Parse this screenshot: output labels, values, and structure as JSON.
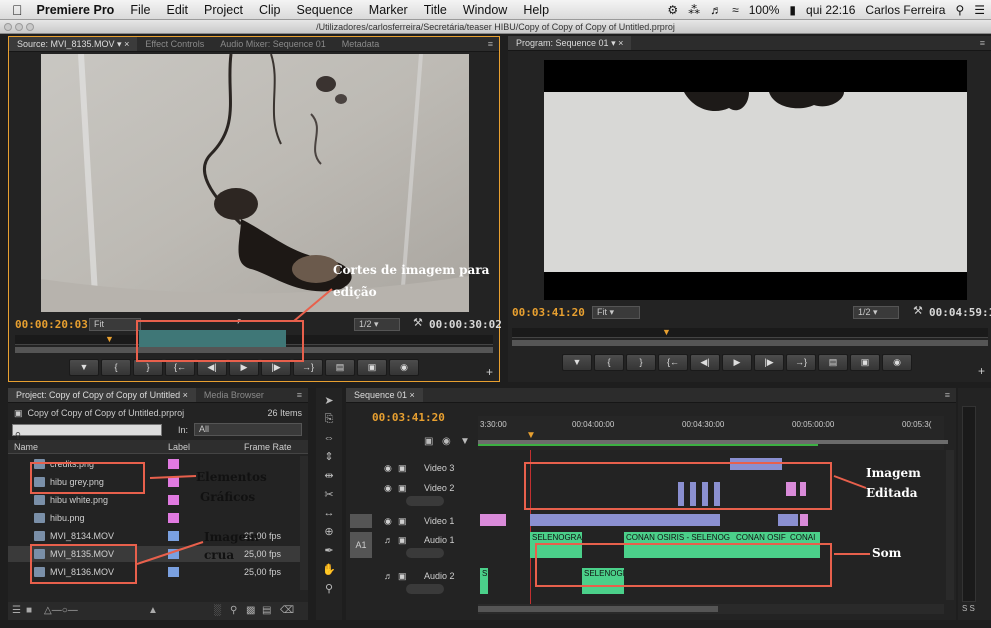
{
  "menubar": {
    "app": "Premiere Pro",
    "items": [
      "File",
      "Edit",
      "Project",
      "Clip",
      "Sequence",
      "Marker",
      "Title",
      "Window",
      "Help"
    ],
    "battery": "100%",
    "clock": "qui 22:16",
    "user": "Carlos Ferreira"
  },
  "window": {
    "path": "/Utilizadores/carlosferreira/Secretária/teaser HIBU/Copy of Copy of Copy of Untitled.prproj"
  },
  "source": {
    "tabs": [
      "Source: MVI_8135.MOV",
      "Effect Controls",
      "Audio Mixer: Sequence 01",
      "Metadata"
    ],
    "timecode": "00:00:20:03",
    "fit": "Fit",
    "ratio": "1/2",
    "duration": "00:00:30:02"
  },
  "program": {
    "tab": "Program: Sequence 01",
    "timecode": "00:03:41:20",
    "fit": "Fit",
    "ratio": "1/2",
    "duration": "00:04:59:1"
  },
  "project": {
    "tabs": [
      "Project: Copy of Copy of Copy of Untitled",
      "Media Browser"
    ],
    "file": "Copy of Copy of Copy of Untitled.prproj",
    "count": "26 Items",
    "in_label": "In:",
    "in_value": "All",
    "columns": [
      "Name",
      "Label",
      "Frame Rate"
    ],
    "rows": [
      {
        "name": "credits.png",
        "color": "#e07ae0",
        "fps": ""
      },
      {
        "name": "hibu grey.png",
        "color": "#e07ae0",
        "fps": ""
      },
      {
        "name": "hibu white.png",
        "color": "#e07ae0",
        "fps": ""
      },
      {
        "name": "hibu.png",
        "color": "#e07ae0",
        "fps": ""
      },
      {
        "name": "MVI_8134.MOV",
        "color": "#7aa0e0",
        "fps": "25,00 fps"
      },
      {
        "name": "MVI_8135.MOV",
        "color": "#7aa0e0",
        "fps": "25,00 fps"
      },
      {
        "name": "MVI_8136.MOV",
        "color": "#7aa0e0",
        "fps": "25,00 fps"
      }
    ]
  },
  "timeline": {
    "tab": "Sequence 01",
    "timecode": "00:03:41:20",
    "ruler": [
      "3:30:00",
      "00:04:00:00",
      "00:04:30:00",
      "00:05:00:00",
      "00:05:3("
    ],
    "tracks": [
      "Video 3",
      "Video 2",
      "Video 1",
      "Audio 1",
      "Audio 2"
    ],
    "a1_label": "A1",
    "audio_clips_a1": [
      "SELENOGRA",
      "CONAN OSIRIS - SELENOG",
      "CONAN OSIF",
      "CONAI"
    ],
    "audio_clips_a2": [
      "S",
      "SELENOGI"
    ]
  },
  "annotations": {
    "cortes": "Cortes de imagem para",
    "edicao": "edição",
    "elementos": "Elementos",
    "graficos": "Gráficos",
    "imagem": "Imagem",
    "crua": "crua",
    "imagem2": "Imagem",
    "editada": "Editada",
    "som": "Som"
  },
  "colors": {
    "accent": "#e8a030",
    "annotation": "#e8604c"
  }
}
